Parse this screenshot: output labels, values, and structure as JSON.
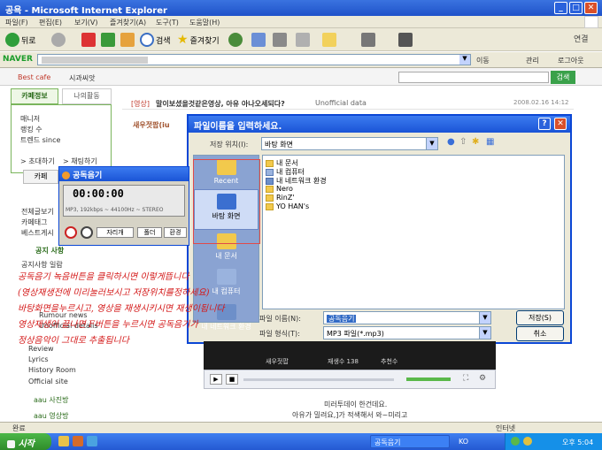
{
  "window": {
    "title": "공욕 - Microsoft Internet Explorer"
  },
  "menu": [
    "파일(F)",
    "편집(E)",
    "보기(V)",
    "즐겨찾기(A)",
    "도구(T)",
    "도움말(H)"
  ],
  "toolbar": {
    "back": "뒤로",
    "search": "검색",
    "favorites": "즐겨찾기",
    "connect": "연결"
  },
  "addressbar": {
    "naver_label": "NAVER",
    "move_label": "이동",
    "manage_label": "관리",
    "login_label": "로그아웃"
  },
  "linksbar": {
    "best_cafe": "Best cafe",
    "search_button": "검색",
    "shortcut": "시과씨앗"
  },
  "page": {
    "tab_cafe_info": "카페정보",
    "tab_my_activity": "나의활동",
    "member_label": "매니저",
    "rank_label": "랭킹 수",
    "since_label": "트렌드 since",
    "invite": "> 초대하기",
    "write": "> 채팅하기",
    "cafe_btn": "카페",
    "post_category": "[영상]",
    "post_title": "말이보셨을것같은영상, 아유 아나오세되다?",
    "post_extra": "Unofficial data",
    "post_date": "2008.02.16 14:12",
    "author": "새우젓팝(iu",
    "menu_items": [
      "전체글보기",
      "카페태그",
      "베스트게시"
    ],
    "notice_header": "공지 사항",
    "notice_items": [
      "공지사항 일람"
    ],
    "lower_items": [
      "Rumour news",
      "Unofficial details",
      "Review",
      "Lyrics",
      "History Room",
      "Official site"
    ],
    "section_video": "aau 사진방",
    "section_sound": "aau 영상방"
  },
  "player": {
    "title": "공독음기",
    "time": "00:00:00",
    "info": "MP3, 192kbps ~ 44100Hz ~ STEREO",
    "record_label": "자리개",
    "folder_label": "폴더",
    "settings_label": "환경"
  },
  "dialog": {
    "title": "파일이름을 입력하세요.",
    "save_in_label": "저장 위치(I):",
    "save_in_value": "바탕 화면",
    "places": [
      "Recent",
      "바탕 화면",
      "내 문서",
      "내 컴퓨터",
      "내 네트워크 환경"
    ],
    "files": [
      "내 문서",
      "내 컴퓨터",
      "내 네트워크 환경",
      "Nero",
      "RinZ'",
      "YO HAN's"
    ],
    "filename_label": "파일 이름(N):",
    "filename_value": "공독음기",
    "filetype_label": "파일 형식(T):",
    "filetype_value": "MP3 파일(*.mp3)",
    "save_button": "저장(S)",
    "cancel_button": "취소"
  },
  "handwriting": [
    "공독음기 녹음버튼을 클릭하시면 이렇게뜹니다",
    "(영상재생전에 미리눌러보시고 저장위치를정하세요)",
    "바탕화면을누르시고, 영상을 재생시키시면 재생이됩니다",
    "영상재생이 끝나면 F버튼을 누르시면 공독음기가",
    "정상음악이 그대로 추출됩니다"
  ],
  "video": {
    "caption_left": "새우젓팝",
    "caption_mid": "재생수 138",
    "caption_right": "추천수"
  },
  "below_text": [
    "미러투데이 한건데요.",
    "아유가 밀려요,]가 적색해서 와~미리고"
  ],
  "status": {
    "done": "완료",
    "zone": "인터넷"
  },
  "taskbar": {
    "start": "시작",
    "tasks": [
      "공독음기"
    ],
    "ime": "KO",
    "clock": "오후 5:04"
  }
}
